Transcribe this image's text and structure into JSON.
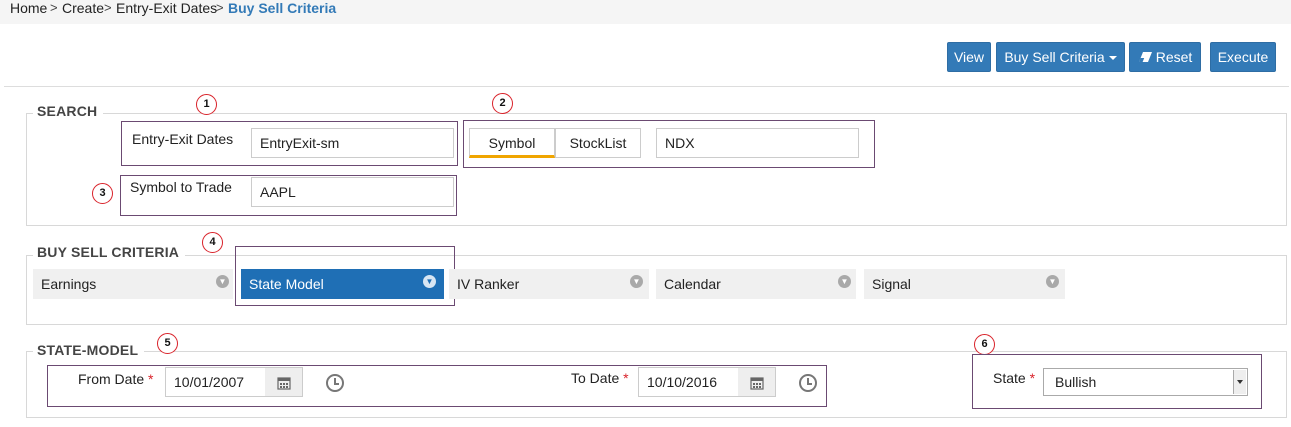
{
  "breadcrumb": {
    "items": [
      "Home",
      "Create",
      "Entry-Exit Dates",
      "Buy Sell Criteria"
    ],
    "separator": ">"
  },
  "toolbar": {
    "view_label": "View",
    "buy_sell_label": "Buy Sell Criteria",
    "reset_label": "Reset",
    "execute_label": "Execute"
  },
  "search": {
    "legend": "SEARCH",
    "entry_exit_label": "Entry-Exit Dates",
    "entry_exit_value": "EntryExit-sm",
    "segment": [
      "Symbol",
      "StockList"
    ],
    "segment_selected": "Symbol",
    "stocklist_value": "NDX",
    "symbol_label": "Symbol to Trade",
    "symbol_value": "AAPL"
  },
  "buy_sell": {
    "legend": "BUY SELL CRITERIA",
    "tabs": [
      "Earnings",
      "State Model",
      "IV Ranker",
      "Calendar",
      "Signal"
    ],
    "selected": "State Model"
  },
  "state_model": {
    "legend": "STATE-MODEL",
    "from_label": "From Date",
    "from_value": "10/01/2007",
    "to_label": "To Date",
    "to_value": "10/10/2016",
    "state_label": "State",
    "state_value": "Bullish",
    "required_mark": "*"
  },
  "callouts": [
    "1",
    "2",
    "3",
    "4",
    "5",
    "6"
  ],
  "colors": {
    "primary": "#337ab7",
    "selected_tab": "#1f6fb5",
    "accent_underline": "#f0a500",
    "callout_border": "#6b4a72",
    "callout_number": "#d9222a"
  }
}
